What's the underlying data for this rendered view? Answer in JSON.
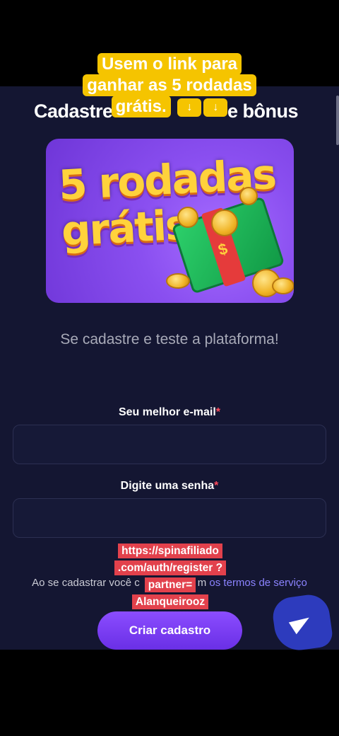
{
  "page": {
    "title_left": "Cadastre",
    "title_right": "e bônus",
    "banner_line1": "5 rodadas",
    "banner_line2": "grátis",
    "subtitle": "Se cadastre e teste a plataforma!"
  },
  "overlay": {
    "caption": "Usem o link para ganhar as 5 rodadas grátis.",
    "link_text": "https://spinafiliado .com/auth/register ?partner= Alanqueirooz"
  },
  "form": {
    "email_label": "Seu melhor e-mail",
    "password_label": "Digite uma senha",
    "required_mark": "*",
    "email_value": "",
    "password_value": "",
    "terms_prefix": "Ao se cadastrar você c",
    "terms_middle": "m ",
    "terms_link": "os termos de serviço",
    "submit_label": "Criar cadastro"
  },
  "colors": {
    "background": "#141632",
    "accent": "#7b3ff2",
    "link": "#8b83ff",
    "required": "#ff4b5c"
  },
  "icons": {
    "fab": "paper-plane-icon",
    "arrows": "down-arrow-icon"
  }
}
